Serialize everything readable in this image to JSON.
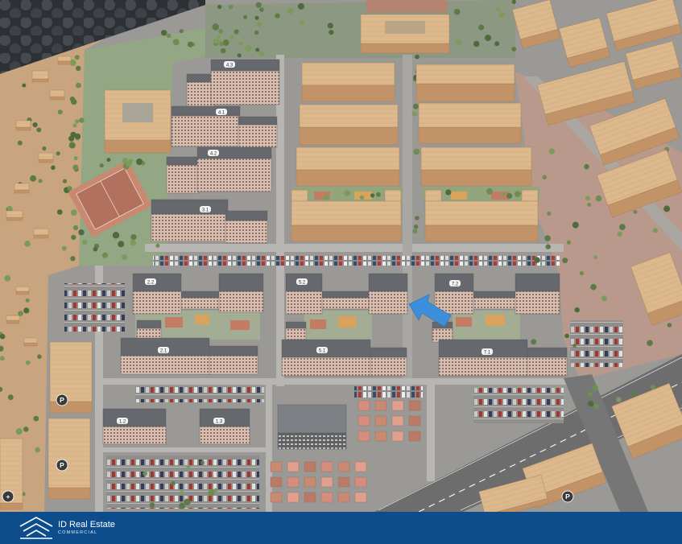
{
  "banner": {
    "brand_name": "ID Real Estate",
    "brand_tagline": "COMMERCIAL"
  },
  "building_labels": {
    "b4_3": "4.3",
    "b4_1": "4.1",
    "b4_2": "4.2",
    "b3_1": "3.1",
    "b2_2": "2.2",
    "b2_1": "2.1",
    "b5_2": "5.2",
    "b5_1": "5.1",
    "b7_2": "7.2",
    "b7_1": "7.1",
    "b1_2": "1.2",
    "b1_3": "1.3"
  },
  "map_signs": {
    "parking": "P",
    "medical": "+"
  },
  "colors": {
    "banner": "#0d4d8c",
    "arrow": "#3d8fdc",
    "wood_roof": "#dcb88d",
    "wood_facade": "#c29366",
    "residential_roof": "#65686d"
  }
}
